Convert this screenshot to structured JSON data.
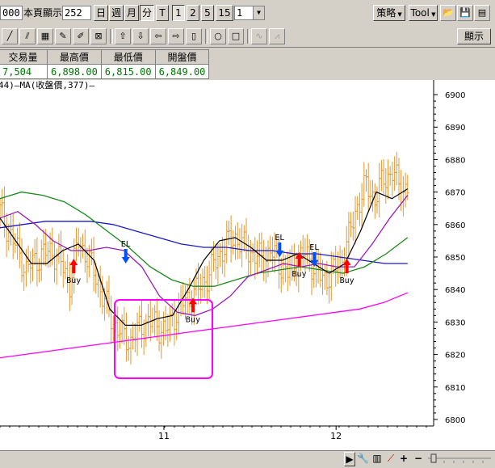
{
  "toolbar": {
    "period_value": "000",
    "page_label": "本頁顯示",
    "page_value": "252",
    "period_buttons": [
      "日",
      "週",
      "月",
      "分"
    ],
    "tick_button": "T",
    "interval_buttons": [
      "1",
      "2",
      "5",
      "15"
    ],
    "interval_select": "1",
    "strategy_label": "策略",
    "tool_label": "Tool",
    "display_label": "顯示"
  },
  "quote": {
    "headers": [
      "交易量",
      "最高價",
      "最低價",
      "開盤價"
    ],
    "values": [
      "7,504",
      "6,898.00",
      "6,815.00",
      "6,849.00"
    ]
  },
  "legend": {
    "text": "44)—MA(收盤價,377)—",
    "ma_color": "#ff00ff"
  },
  "colors": {
    "candle": "#e8962a",
    "black_line": "#000000",
    "purple_line": "#9a1cb8",
    "green_line": "#1a8a1a",
    "blue_line": "#1a1ac8",
    "magenta_line": "#ff00ff",
    "buy_arrow": "#ff0000",
    "sell_arrow": "#0050ff",
    "highlight_box": "#ff00ff"
  },
  "chart_data": {
    "type": "line",
    "y_ticks": [
      "6900",
      "6890",
      "6880",
      "6870",
      "6860",
      "6850",
      "6840",
      "6830",
      "6820",
      "6810",
      "6800"
    ],
    "x_ticks": [
      "11",
      "12"
    ],
    "ylim": [
      6798,
      6903
    ],
    "annotations": [
      {
        "label": "Buy",
        "kind": "buy",
        "x": 0.17,
        "price": 6846
      },
      {
        "label": "EL",
        "kind": "sell",
        "x": 0.29,
        "price": 6850
      },
      {
        "label": "Buy",
        "kind": "buy",
        "x": 0.445,
        "price": 6834
      },
      {
        "label": "EL",
        "kind": "sell",
        "x": 0.645,
        "price": 6852
      },
      {
        "label": "Buy",
        "kind": "buy",
        "x": 0.69,
        "price": 6848
      },
      {
        "label": "EL",
        "kind": "sell",
        "x": 0.725,
        "price": 6849
      },
      {
        "label": "Buy",
        "kind": "buy",
        "x": 0.8,
        "price": 6846
      }
    ],
    "series": [
      {
        "key": "magenta",
        "values": [
          6819,
          6820,
          6821,
          6822,
          6823,
          6824,
          6825,
          6826,
          6827,
          6828,
          6829,
          6830,
          6831,
          6832,
          6833,
          6834,
          6836,
          6839
        ]
      },
      {
        "key": "blue",
        "values": [
          6859,
          6860,
          6861,
          6861,
          6861,
          6860,
          6858,
          6856,
          6854,
          6853,
          6853,
          6852,
          6852,
          6851,
          6851,
          6850,
          6849,
          6848,
          6848
        ]
      },
      {
        "key": "green",
        "values": [
          6868,
          6870,
          6869,
          6867,
          6863,
          6858,
          6853,
          6847,
          6843,
          6841,
          6841,
          6843,
          6845,
          6846,
          6847,
          6846,
          6845,
          6847,
          6851,
          6856
        ]
      },
      {
        "key": "purple",
        "values": [
          6862,
          6864,
          6860,
          6855,
          6852,
          6852,
          6853,
          6852,
          6847,
          6838,
          6833,
          6832,
          6834,
          6838,
          6844,
          6846,
          6848,
          6847,
          6848,
          6847,
          6847,
          6854,
          6862,
          6869
        ]
      },
      {
        "key": "black",
        "values": [
          6862,
          6855,
          6848,
          6848,
          6852,
          6854,
          6849,
          6834,
          6829,
          6829,
          6831,
          6832,
          6840,
          6849,
          6855,
          6856,
          6853,
          6849,
          6849,
          6851,
          6848,
          6845,
          6848,
          6858,
          6870,
          6868,
          6871
        ]
      },
      {
        "key": "candles",
        "values": [
          6864,
          6858,
          6852,
          6846,
          6849,
          6851,
          6852,
          6848,
          6842,
          6855,
          6850,
          6844,
          6836,
          6830,
          6826,
          6824,
          6828,
          6830,
          6829,
          6827,
          6832,
          6836,
          6838,
          6841,
          6845,
          6850,
          6854,
          6856,
          6853,
          6851,
          6849,
          6852,
          6848,
          6845,
          6849,
          6851,
          6847,
          6843,
          6845,
          6848,
          6856,
          6866,
          6872,
          6868,
          6874,
          6876,
          6871
        ]
      }
    ]
  }
}
